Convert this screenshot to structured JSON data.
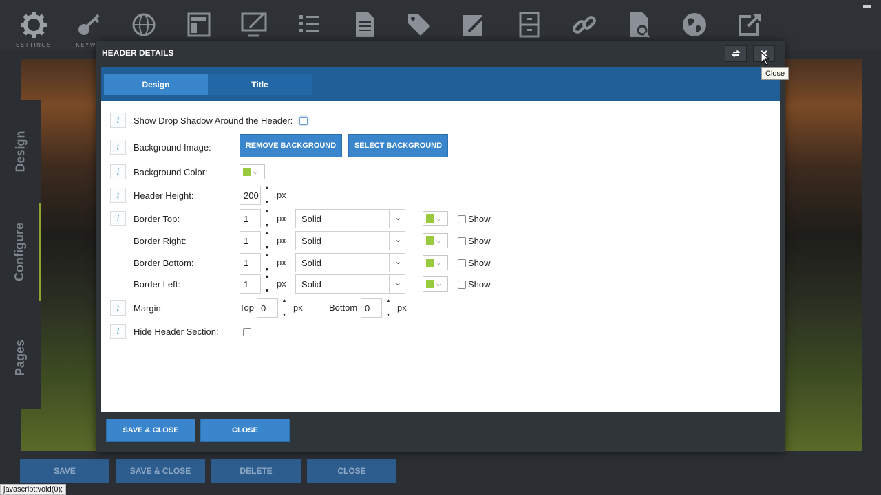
{
  "toolbar": {
    "items": [
      {
        "icon": "gear-icon",
        "label": "SETTINGS"
      },
      {
        "icon": "key-icon",
        "label": "KEYWO"
      },
      {
        "icon": "globe-grid-icon",
        "label": ""
      },
      {
        "icon": "layout-icon",
        "label": ""
      },
      {
        "icon": "monitor-edit-icon",
        "label": ""
      },
      {
        "icon": "list-icon",
        "label": ""
      },
      {
        "icon": "document-icon",
        "label": ""
      },
      {
        "icon": "tag-icon",
        "label": ""
      },
      {
        "icon": "pencil-icon",
        "label": ""
      },
      {
        "icon": "cabinet-icon",
        "label": ""
      },
      {
        "icon": "link-icon",
        "label": ""
      },
      {
        "icon": "search-document-icon",
        "label": ""
      },
      {
        "icon": "world-icon",
        "label": ""
      },
      {
        "icon": "external-link-icon",
        "label": ""
      }
    ]
  },
  "rail": {
    "tabs": [
      {
        "label": "Design"
      },
      {
        "label": "Configure"
      },
      {
        "label": "Pages"
      }
    ]
  },
  "modal": {
    "title": "HEADER DETAILS",
    "tabs": [
      {
        "label": "Design"
      },
      {
        "label": "Title"
      }
    ],
    "tooltip": "Close",
    "info_glyph": "i",
    "shadow": {
      "label": "Show Drop Shadow Around the Header:"
    },
    "bg_image": {
      "label": "Background Image:",
      "remove_label": "REMOVE BACKGROUND",
      "select_label": "SELECT BACKGROUND"
    },
    "bg_color": {
      "label": "Background Color:",
      "color": "#99c93c"
    },
    "height": {
      "label": "Header Height:",
      "value": "200",
      "unit": "px"
    },
    "borders": [
      {
        "label": "Border Top:",
        "width": "1",
        "unit": "px",
        "style": "Solid",
        "color": "#99c93c",
        "show_label": "Show"
      },
      {
        "label": "Border Right:",
        "width": "1",
        "unit": "px",
        "style": "Solid",
        "color": "#99c93c",
        "show_label": "Show"
      },
      {
        "label": "Border Bottom:",
        "width": "1",
        "unit": "px",
        "style": "Solid",
        "color": "#99c93c",
        "show_label": "Show"
      },
      {
        "label": "Border Left:",
        "width": "1",
        "unit": "px",
        "style": "Solid",
        "color": "#99c93c",
        "show_label": "Show"
      }
    ],
    "margin": {
      "label": "Margin:",
      "top_label": "Top",
      "top_value": "0",
      "bottom_label": "Bottom",
      "bottom_value": "0",
      "unit": "px"
    },
    "hide": {
      "label": "Hide Header Section:"
    },
    "footer": {
      "save_close_label": "SAVE & CLOSE",
      "close_label": "CLOSE"
    }
  },
  "bottom_bar": {
    "save_label": "SAVE",
    "save_close_label": "SAVE & CLOSE",
    "delete_label": "DELETE",
    "close_label": "CLOSE"
  },
  "status_text": "javascript:void(0);"
}
